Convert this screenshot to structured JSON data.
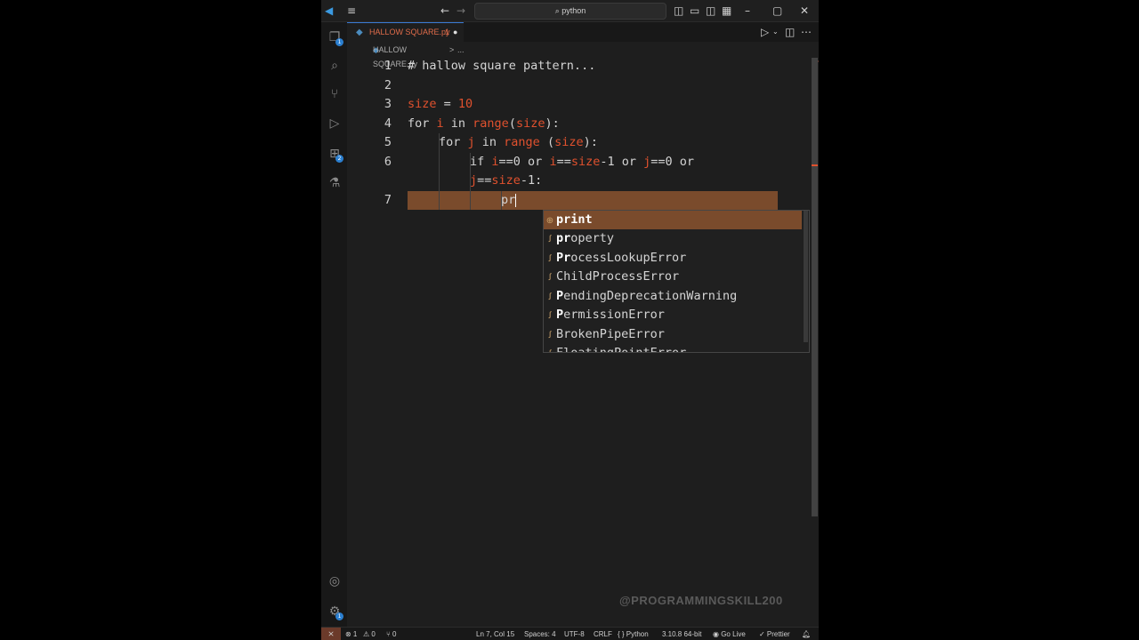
{
  "titlebar": {
    "search_text": "python",
    "nav_back": "←",
    "nav_forward": "→"
  },
  "activity": {
    "explorer_badge": "1",
    "extensions_badge": "2",
    "settings_badge": "1"
  },
  "tab": {
    "filename": "HALLOW SQUARE.py",
    "modified_flag": "1",
    "unsaved_dot": "●"
  },
  "breadcrumb": {
    "file": "HALLOW SQUARE.py",
    "separator": ">",
    "ellipsis": "..."
  },
  "editor": {
    "line_numbers": [
      "1",
      "2",
      "3",
      "4",
      "5",
      "6",
      "",
      "7"
    ],
    "lines": [
      {
        "t1": "# hallow square pattern..."
      },
      {
        "t1": ""
      },
      {
        "a": "size",
        "b": " = ",
        "c": "10"
      },
      {
        "a": "for ",
        "b": "i",
        "c": " in ",
        "d": "range",
        "e": "(",
        "f": "size",
        "g": "):"
      },
      {
        "a": "for ",
        "b": "j",
        "c": " in ",
        "d": "range",
        "e": " (",
        "f": "size",
        "g": "):"
      },
      {
        "a": "if ",
        "b": "i",
        "c": "==0 or ",
        "d": "i",
        "e": "==",
        "f": "size",
        "g": "-1 or ",
        "h": "j",
        "i": "==0 or"
      },
      {
        "a": "j",
        "b": "==",
        "c": "size",
        "d": "-1:"
      },
      {
        "a": "pr"
      }
    ]
  },
  "suggestions": [
    {
      "match": "pr",
      "rest": "int",
      "icon": "⊕"
    },
    {
      "match": "pr",
      "rest": "operty",
      "icon": "ꭍ"
    },
    {
      "match": "Pr",
      "rest": "ocessLookupError",
      "icon": "ꭍ"
    },
    {
      "match": "ChildPr",
      "rest": "ocessError",
      "icon": "ꭍ",
      "plain": true
    },
    {
      "match": "P",
      "rest": "endingDeprecationWarning",
      "icon": "ꭍ"
    },
    {
      "match": "P",
      "rest": "ermissionError",
      "icon": "ꭍ"
    },
    {
      "match": "BrokenP",
      "rest": "ipeError",
      "icon": "ꭍ",
      "plain": true
    },
    {
      "match": "FloatingPointError",
      "rest": "",
      "icon": "ꭍ",
      "plain": true
    }
  ],
  "status": {
    "errors": "⊗ 1",
    "warnings": "⚠ 0",
    "ports": "⑂ 0",
    "position": "Ln 7, Col 15",
    "spaces": "Spaces: 4",
    "encoding": "UTF-8",
    "eol": "CRLF",
    "language": "{ } Python",
    "interpreter": "3.10.8 64-bit",
    "golive": "Go Live",
    "prettier": "✓ Prettier"
  },
  "watermark": "@PROGRAMMINGSKILL200",
  "colors": {
    "accent": "#e0512e",
    "selection": "#7a4b2c"
  }
}
